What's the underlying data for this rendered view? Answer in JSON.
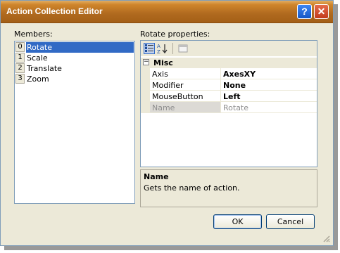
{
  "window": {
    "title": "Action Collection Editor",
    "help_glyph": "?",
    "close_glyph": "✕"
  },
  "members": {
    "label": "Members:",
    "items": [
      {
        "index": "0",
        "name": "Rotate",
        "selected": true
      },
      {
        "index": "1",
        "name": "Scale"
      },
      {
        "index": "2",
        "name": "Translate"
      },
      {
        "index": "3",
        "name": "Zoom"
      }
    ]
  },
  "properties": {
    "label": "Rotate properties:",
    "toolbar": [
      "categorized-icon",
      "alphabetical-icon",
      "property-pages-icon"
    ],
    "category": {
      "expander": "−",
      "name": "Misc"
    },
    "rows": [
      {
        "name": "Axis",
        "value": "AxesXY"
      },
      {
        "name": "Modifier",
        "value": "None"
      },
      {
        "name": "MouseButton",
        "value": "Left"
      },
      {
        "name": "Name",
        "value": "Rotate",
        "readonly": true
      }
    ]
  },
  "help": {
    "title": "Name",
    "description": "Gets the name of action."
  },
  "buttons": {
    "ok": "OK",
    "cancel": "Cancel"
  },
  "colors": {
    "titlebar": "#c67b24",
    "selection": "#316ac5",
    "dialog_bg": "#ece9d8"
  }
}
